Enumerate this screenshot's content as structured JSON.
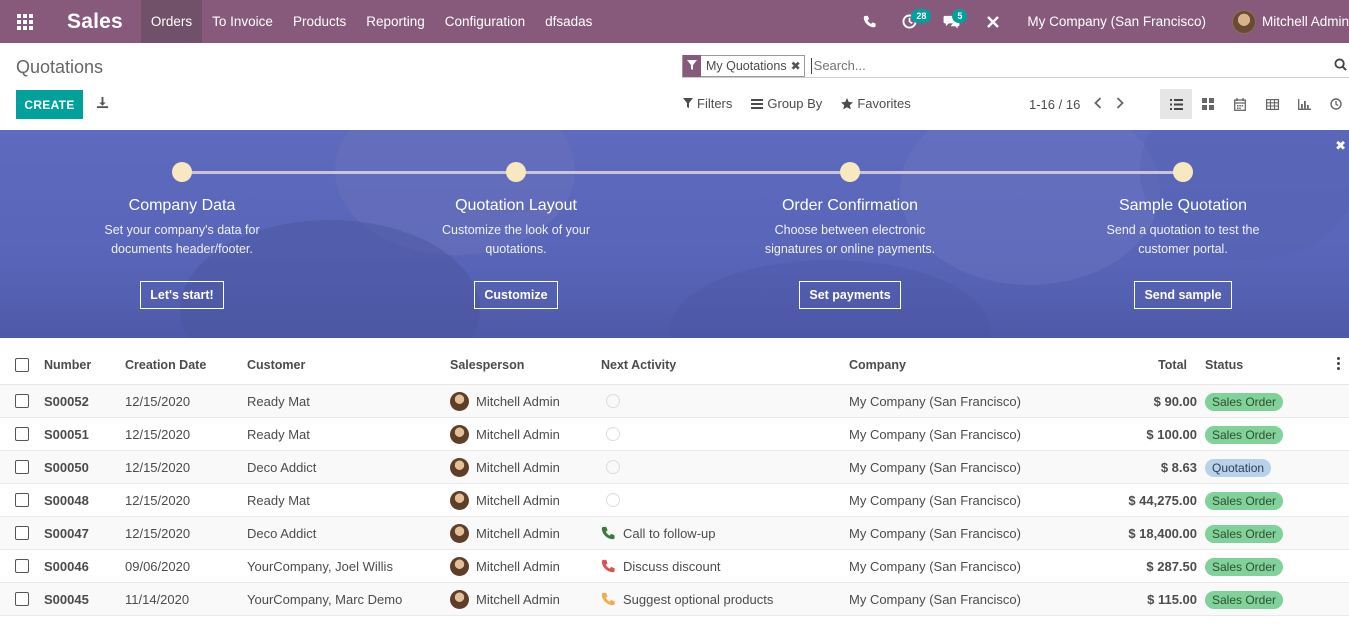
{
  "navbar": {
    "app_title": "Sales",
    "menu": [
      "Orders",
      "To Invoice",
      "Products",
      "Reporting",
      "Configuration",
      "dfsadas"
    ],
    "activity_count": "28",
    "messages_count": "5",
    "company": "My Company (San Francisco)",
    "user": "Mitchell Admin"
  },
  "control": {
    "breadcrumb": "Quotations",
    "facet": "My Quotations",
    "facet_remove": "✖",
    "search_placeholder": "Search...",
    "create_label": "CREATE",
    "filters": "Filters",
    "group_by": "Group By",
    "favorites": "Favorites",
    "pager": "1-16 / 16"
  },
  "banner": {
    "steps": [
      {
        "title": "Company Data",
        "desc": "Set your company's data for documents header/footer.",
        "button": "Let's start!"
      },
      {
        "title": "Quotation Layout",
        "desc": "Customize the look of your quotations.",
        "button": "Customize"
      },
      {
        "title": "Order Confirmation",
        "desc": "Choose between electronic signatures or online payments.",
        "button": "Set payments"
      },
      {
        "title": "Sample Quotation",
        "desc": "Send a quotation to test the customer portal.",
        "button": "Send sample"
      }
    ]
  },
  "table": {
    "headers": {
      "number": "Number",
      "date": "Creation Date",
      "customer": "Customer",
      "salesperson": "Salesperson",
      "activity": "Next Activity",
      "company": "Company",
      "total": "Total",
      "status": "Status"
    },
    "rows": [
      {
        "number": "S00052",
        "date": "12/15/2020",
        "customer": "Ready Mat",
        "salesperson": "Mitchell Admin",
        "activity": "",
        "company": "My Company (San Francisco)",
        "total": "$ 90.00",
        "status": "Sales Order"
      },
      {
        "number": "S00051",
        "date": "12/15/2020",
        "customer": "Ready Mat",
        "salesperson": "Mitchell Admin",
        "activity": "",
        "company": "My Company (San Francisco)",
        "total": "$ 100.00",
        "status": "Sales Order"
      },
      {
        "number": "S00050",
        "date": "12/15/2020",
        "customer": "Deco Addict",
        "salesperson": "Mitchell Admin",
        "activity": "",
        "company": "My Company (San Francisco)",
        "total": "$ 8.63",
        "status": "Quotation"
      },
      {
        "number": "S00048",
        "date": "12/15/2020",
        "customer": "Ready Mat",
        "salesperson": "Mitchell Admin",
        "activity": "",
        "company": "My Company (San Francisco)",
        "total": "$ 44,275.00",
        "status": "Sales Order"
      },
      {
        "number": "S00047",
        "date": "12/15/2020",
        "customer": "Deco Addict",
        "salesperson": "Mitchell Admin",
        "activity": "Call to follow-up",
        "company": "My Company (San Francisco)",
        "total": "$ 18,400.00",
        "status": "Sales Order"
      },
      {
        "number": "S00046",
        "date": "09/06/2020",
        "customer": "YourCompany, Joel Willis",
        "salesperson": "Mitchell Admin",
        "activity": "Discuss discount",
        "company": "My Company (San Francisco)",
        "total": "$ 287.50",
        "status": "Sales Order"
      },
      {
        "number": "S00045",
        "date": "11/14/2020",
        "customer": "YourCompany, Marc Demo",
        "salesperson": "Mitchell Admin",
        "activity": "Suggest optional products",
        "company": "My Company (San Francisco)",
        "total": "$ 115.00",
        "status": "Sales Order"
      }
    ]
  },
  "colors": {
    "brand": "#875a7b",
    "accent": "#00a09d",
    "sales_order_badge": "#80d19a",
    "quotation_badge": "#b9d2ea",
    "activity_phone_green": "#3a7a3a",
    "activity_phone_red": "#d9534f",
    "activity_phone_orange": "#f0ad4e"
  }
}
